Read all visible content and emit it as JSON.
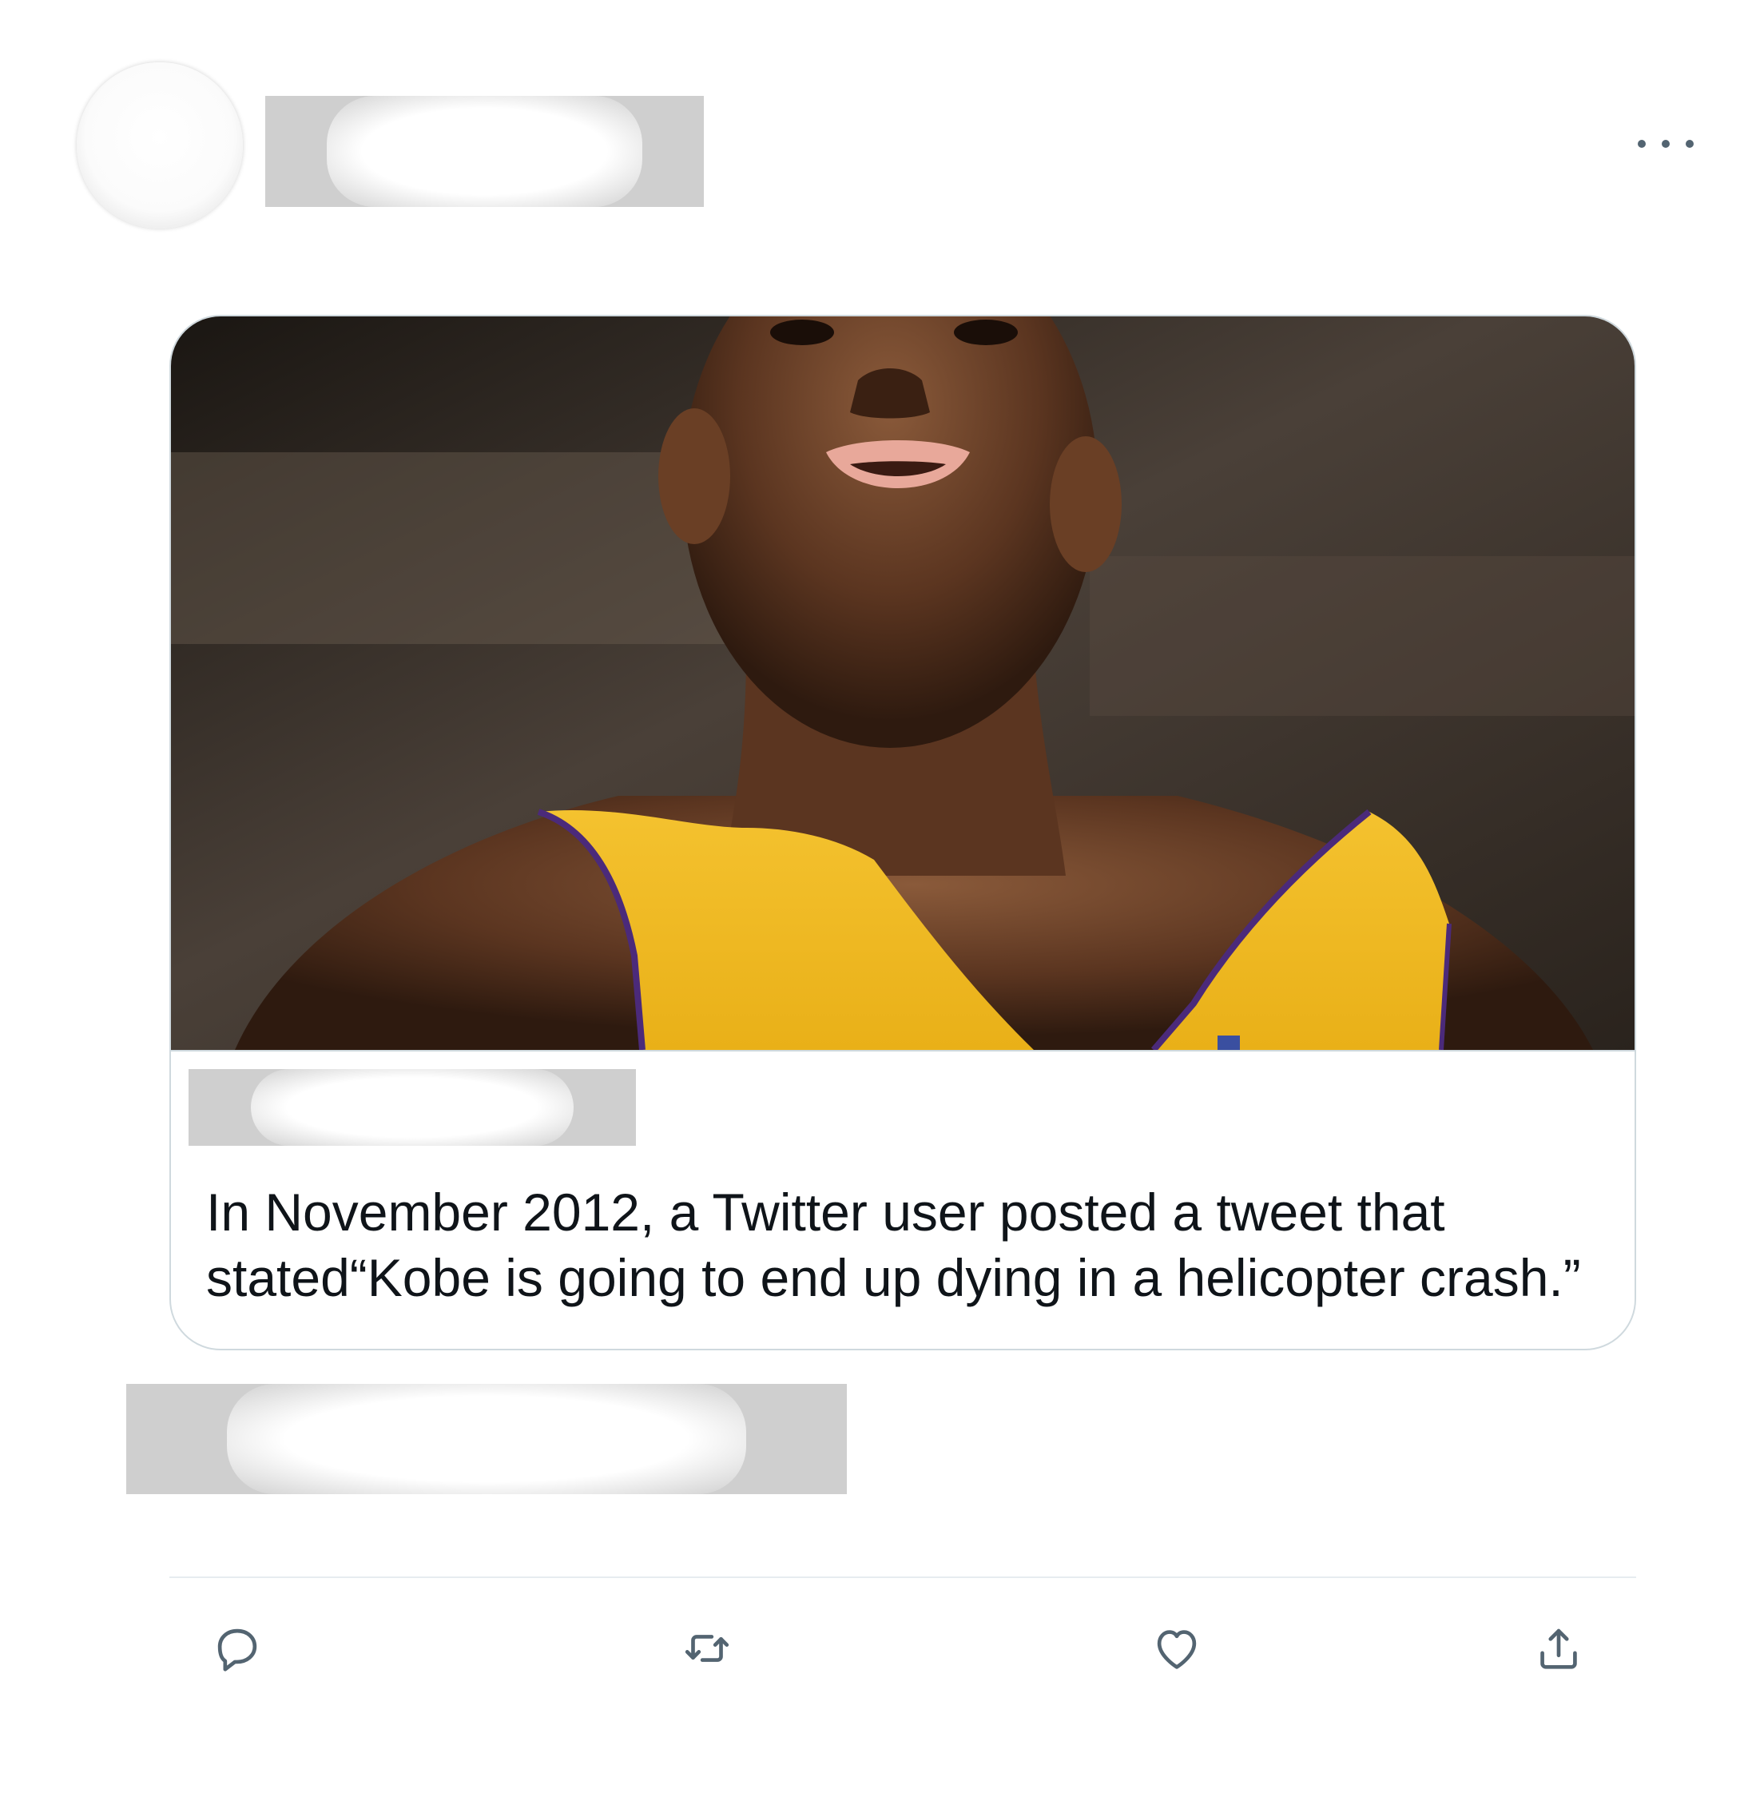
{
  "header": {
    "avatar_icon": "avatar-placeholder",
    "more_icon": "more-horizontal-icon"
  },
  "card": {
    "image_subject": "basketball player in yellow jersey",
    "text": "In November 2012, a Twitter user posted a tweet that stated“Kobe is going to end up dying in a helicopter crash.”"
  },
  "actions": {
    "reply_icon": "reply-icon",
    "retweet_icon": "retweet-icon",
    "like_icon": "heart-icon",
    "share_icon": "share-icon"
  },
  "colors": {
    "icon": "#536471",
    "border": "#cfd9de",
    "text": "#0f1419",
    "jersey": "#f7c631"
  }
}
